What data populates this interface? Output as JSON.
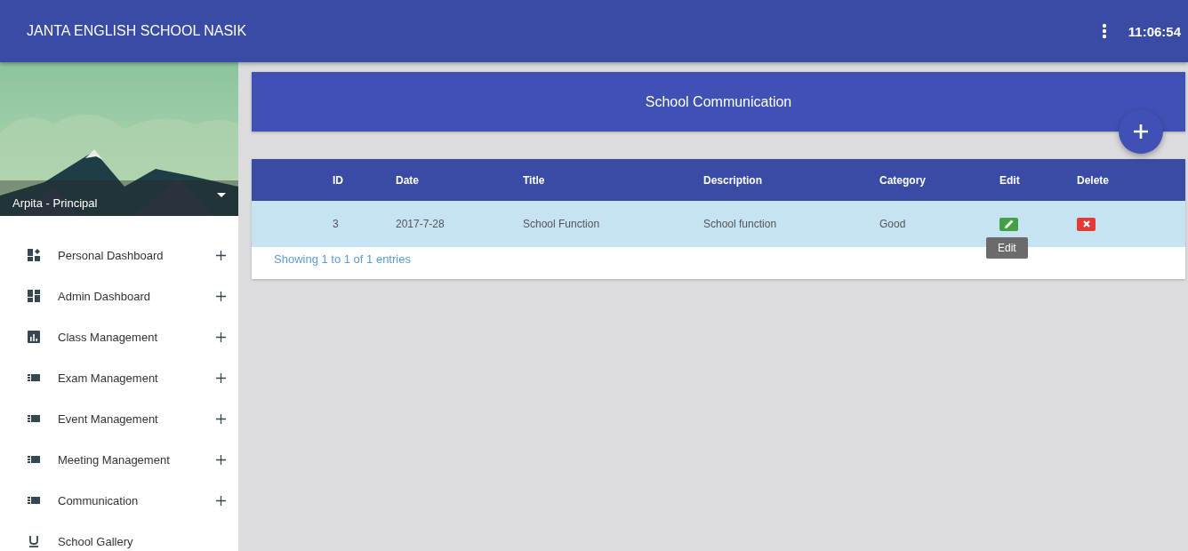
{
  "app_bar": {
    "title": "JANTA ENGLISH SCHOOL NASIK",
    "time": "11:06:54"
  },
  "sidebar": {
    "user": "Arpita - Principal",
    "items": [
      {
        "label": "Personal Dashboard",
        "kind": "dashboard-plus",
        "expandable": true
      },
      {
        "label": "Admin Dashboard",
        "kind": "dashboard",
        "expandable": true
      },
      {
        "label": "Class Management",
        "kind": "chart",
        "expandable": true
      },
      {
        "label": "Exam Management",
        "kind": "list",
        "expandable": true
      },
      {
        "label": "Event Management",
        "kind": "list",
        "expandable": true
      },
      {
        "label": "Meeting Management",
        "kind": "list",
        "expandable": true
      },
      {
        "label": "Communication",
        "kind": "list",
        "expandable": true
      },
      {
        "label": "School Gallery",
        "kind": "underline",
        "expandable": false
      }
    ]
  },
  "page": {
    "title": "School Communication"
  },
  "table": {
    "columns": [
      "ID",
      "Date",
      "Title",
      "Description",
      "Category",
      "Edit",
      "Delete"
    ],
    "rows": [
      {
        "id": "3",
        "date": "2017-7-28",
        "title": "School Function",
        "description": "School function",
        "category": "Good",
        "selected": true
      }
    ],
    "tooltip": "Edit",
    "footer": "Showing 1 to 1 of 1 entries"
  }
}
